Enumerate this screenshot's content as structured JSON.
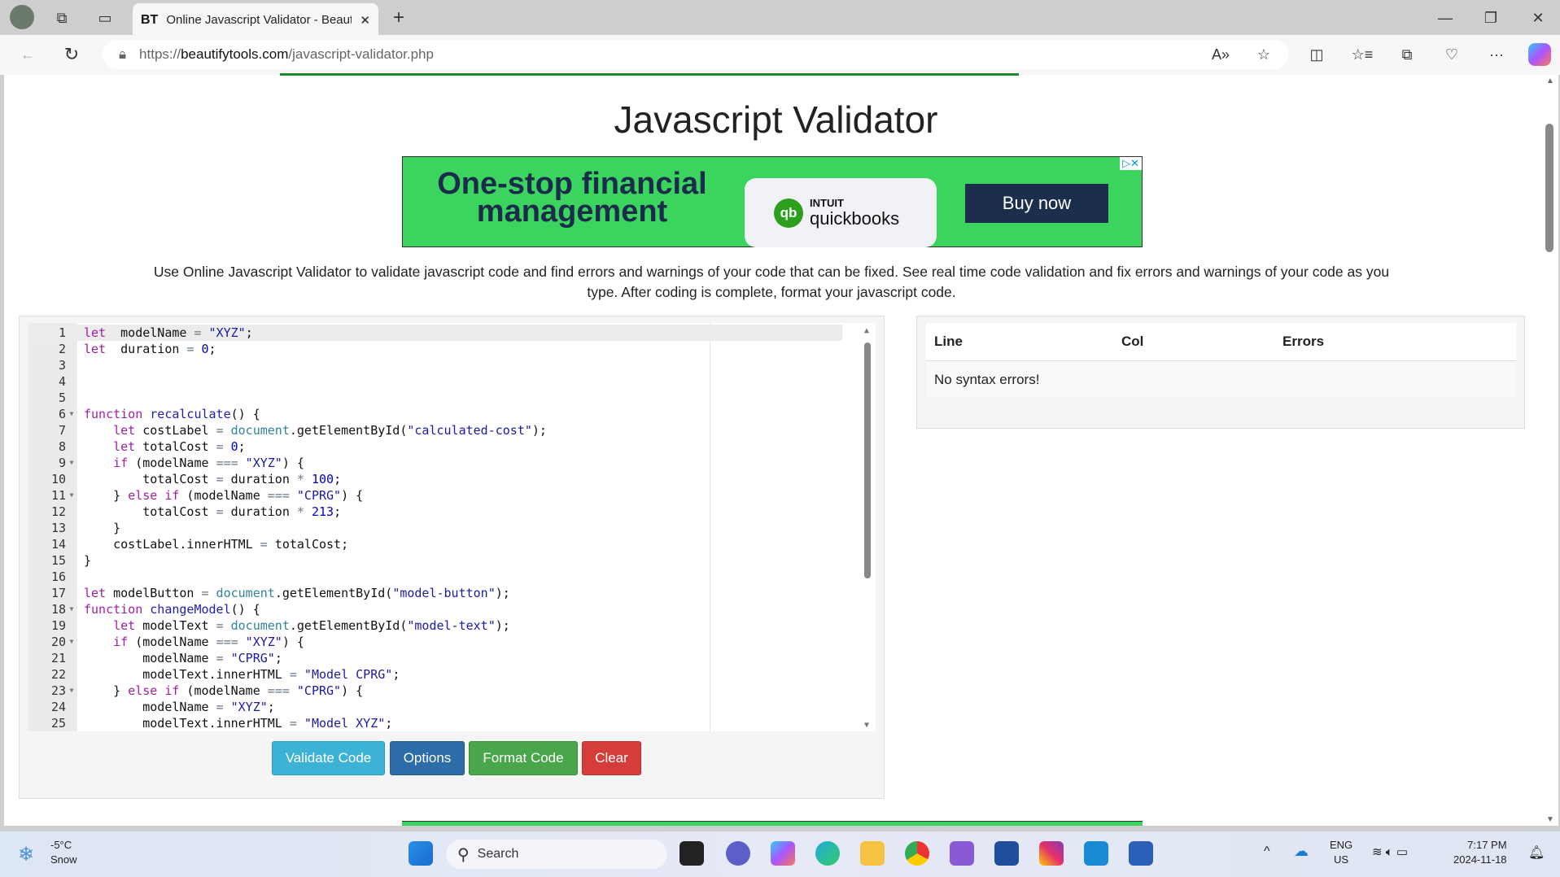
{
  "browser": {
    "tab_title": "Online Javascript Validator - Beautify",
    "favicon": "BT",
    "url_scheme": "https://",
    "url_host": "beautifytools.com",
    "url_path": "/javascript-validator.php"
  },
  "page": {
    "title": "Javascript Validator",
    "description": "Use Online Javascript Validator to validate javascript code and find errors and warnings of your code that can be fixed. See real time code validation and fix errors and warnings of your code as you type. After coding is complete, format your javascript code."
  },
  "ad": {
    "headline": "One-stop financial management",
    "brand_top": "INTUIT",
    "brand": "quickbooks",
    "cta": "Buy now",
    "logo_text": "qb"
  },
  "editor": {
    "lines": [
      [
        [
          "kw",
          "let"
        ],
        [
          "",
          "  modelName "
        ],
        [
          "op",
          "="
        ],
        [
          "",
          ""
        ],
        [
          "str",
          " \"XYZ\""
        ],
        [
          "",
          ";"
        ]
      ],
      [
        [
          "kw",
          "let"
        ],
        [
          "",
          "  duration "
        ],
        [
          "op",
          "="
        ],
        [
          "num",
          " 0"
        ],
        [
          "",
          ";"
        ]
      ],
      [],
      [],
      [],
      [
        [
          "kw",
          "function"
        ],
        [
          "fn",
          " recalculate"
        ],
        [
          "",
          "() {"
        ]
      ],
      [
        [
          "",
          "    "
        ],
        [
          "kw",
          "let"
        ],
        [
          "",
          "",
          " "
        ],
        [
          "",
          " costLabel "
        ],
        [
          "op",
          "="
        ],
        [
          "obj",
          " document"
        ],
        [
          "",
          ".getElementById("
        ],
        [
          "str",
          "\"calculated-cost\""
        ],
        [
          "",
          ");"
        ]
      ],
      [
        [
          "",
          "    "
        ],
        [
          "kw",
          "let"
        ],
        [
          "",
          " totalCost "
        ],
        [
          "op",
          "="
        ],
        [
          "num",
          " 0"
        ],
        [
          "",
          ";"
        ]
      ],
      [
        [
          "",
          "    "
        ],
        [
          "kw",
          "if"
        ],
        [
          "",
          " (modelName "
        ],
        [
          "op",
          "==="
        ],
        [
          "str",
          " \"XYZ\""
        ],
        [
          "",
          ") {"
        ]
      ],
      [
        [
          "",
          "        totalCost "
        ],
        [
          "op",
          "="
        ],
        [
          "",
          " duration "
        ],
        [
          "op",
          "*"
        ],
        [
          "num",
          " 100"
        ],
        [
          "",
          ";"
        ]
      ],
      [
        [
          "",
          "    } "
        ],
        [
          "kw",
          "else if"
        ],
        [
          "",
          " (modelName "
        ],
        [
          "op",
          "==="
        ],
        [
          "str",
          " \"CPRG\""
        ],
        [
          "",
          ") {"
        ]
      ],
      [
        [
          "",
          "        totalCost "
        ],
        [
          "op",
          "="
        ],
        [
          "",
          " duration "
        ],
        [
          "op",
          "*"
        ],
        [
          "num",
          " 213"
        ],
        [
          "",
          ";"
        ]
      ],
      [
        [
          "",
          "    }"
        ]
      ],
      [
        [
          "",
          "    costLabel.innerHTML "
        ],
        [
          "op",
          "="
        ],
        [
          "",
          " totalCost;"
        ]
      ],
      [
        [
          "",
          "}"
        ]
      ],
      [],
      [
        [
          "kw",
          "let"
        ],
        [
          "",
          " modelButton "
        ],
        [
          "op",
          "="
        ],
        [
          "obj",
          " document"
        ],
        [
          "",
          ".getElementById("
        ],
        [
          "str",
          "\"model-button\""
        ],
        [
          "",
          ");"
        ]
      ],
      [
        [
          "kw",
          "function"
        ],
        [
          "fn",
          " changeModel"
        ],
        [
          "",
          "() {"
        ]
      ],
      [
        [
          "",
          "    "
        ],
        [
          "kw",
          "let"
        ],
        [
          "",
          " modelText "
        ],
        [
          "op",
          "="
        ],
        [
          "obj",
          " document"
        ],
        [
          "",
          ".getElementById("
        ],
        [
          "str",
          "\"model-text\""
        ],
        [
          "",
          ");"
        ]
      ],
      [
        [
          "",
          "    "
        ],
        [
          "kw",
          "if"
        ],
        [
          "",
          " (modelName "
        ],
        [
          "op",
          "==="
        ],
        [
          "str",
          " \"XYZ\""
        ],
        [
          "",
          ") {"
        ]
      ],
      [
        [
          "",
          "        modelName "
        ],
        [
          "op",
          "="
        ],
        [
          "str",
          " \"CPRG\""
        ],
        [
          "",
          ";"
        ]
      ],
      [
        [
          "",
          "        modelText.innerHTML "
        ],
        [
          "op",
          "="
        ],
        [
          "str",
          " \"Model CPRG\""
        ],
        [
          "",
          ";"
        ]
      ],
      [
        [
          "",
          "    } "
        ],
        [
          "kw",
          "else if"
        ],
        [
          "",
          " (modelName "
        ],
        [
          "op",
          "==="
        ],
        [
          "str",
          " \"CPRG\""
        ],
        [
          "",
          ") {"
        ]
      ],
      [
        [
          "",
          "        modelName "
        ],
        [
          "op",
          "="
        ],
        [
          "str",
          " \"XYZ\""
        ],
        [
          "",
          ";"
        ]
      ],
      [
        [
          "",
          "        modelText.innerHTML "
        ],
        [
          "op",
          "="
        ],
        [
          "str",
          " \"Model XYZ\""
        ],
        [
          "",
          ";"
        ]
      ]
    ],
    "fold_lines": [
      6,
      9,
      11,
      18,
      20,
      23
    ]
  },
  "buttons": {
    "validate": "Validate Code",
    "options": "Options",
    "format": "Format Code",
    "clear": "Clear"
  },
  "results": {
    "col_line": "Line",
    "col_col": "Col",
    "col_errors": "Errors",
    "message": "No syntax errors!"
  },
  "taskbar": {
    "weather_temp": "-5°C",
    "weather_desc": "Snow",
    "search": "Search",
    "lang1": "ENG",
    "lang2": "US",
    "time": "7:17 PM",
    "date": "2024-11-18"
  }
}
